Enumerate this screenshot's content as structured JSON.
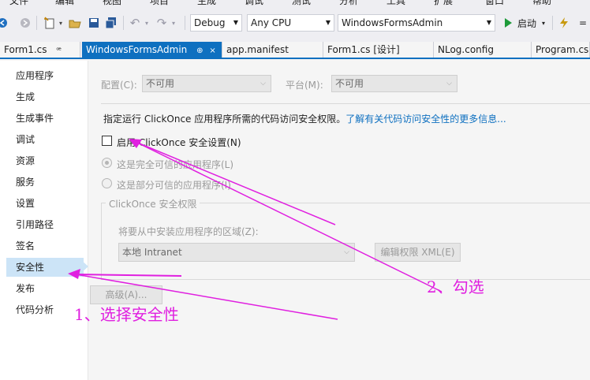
{
  "menubar": {
    "items": [
      "文件",
      "编辑",
      "视图",
      "项目",
      "生成",
      "调试",
      "测试",
      "分析",
      "工具",
      "扩展",
      "窗口",
      "帮助"
    ]
  },
  "toolbar": {
    "config_combo": "Debug",
    "platform_combo": "Any CPU",
    "project_combo": "WindowsFormsAdmin",
    "start_label": "启动"
  },
  "tabs": [
    {
      "label": "Form1.cs",
      "pin": "ꟹ"
    },
    {
      "label": "WindowsFormsAdmin",
      "pin": "⊕ ×"
    },
    {
      "label": "app.manifest"
    },
    {
      "label": "Form1.cs [设计]"
    },
    {
      "label": "NLog.config"
    },
    {
      "label": "Program.cs"
    }
  ],
  "nav": {
    "items": [
      "应用程序",
      "生成",
      "生成事件",
      "调试",
      "资源",
      "服务",
      "设置",
      "引用路径",
      "签名",
      "安全性",
      "发布",
      "代码分析"
    ],
    "selected": "安全性"
  },
  "security": {
    "config_label": "配置(C):",
    "config_value": "不可用",
    "platform_label": "平台(M):",
    "platform_value": "不可用",
    "description": "指定运行 ClickOnce 应用程序所需的代码访问安全权限。",
    "more_info_link": "了解有关代码访问安全性的更多信息...",
    "enable_checkbox_label": "启用 ClickOnce 安全设置(N)",
    "enable_checked": false,
    "full_trust_label": "这是完全可信的应用程序(L)",
    "partial_trust_label": "这是部分可信的应用程序(I)",
    "group_title": "ClickOnce 安全权限",
    "zone_label": "将要从中安装应用程序的区域(Z):",
    "zone_value": "本地 Intranet",
    "edit_xml_button": "编辑权限 XML(E)",
    "advanced_button": "高级(A)..."
  },
  "annotations": {
    "step1": "1、选择安全性",
    "step2": "2、勾选",
    "color": "#e020e0"
  }
}
